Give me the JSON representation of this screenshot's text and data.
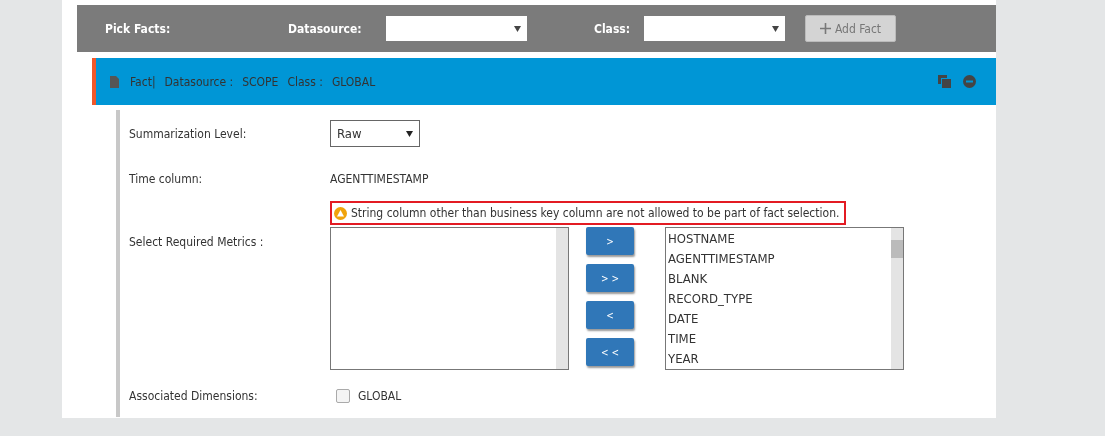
{
  "pick_bar": {
    "title": "Pick Facts:",
    "datasource_label": "Datasource:",
    "class_label": "Class:",
    "add_button": {
      "label": "Add Fact",
      "disabled": true
    }
  },
  "fact": {
    "title": "Fact|",
    "datasource_label": "Datasource :",
    "datasource": "SCOPE",
    "class_label": "Class :",
    "class": "GLOBAL"
  },
  "summarization": {
    "label": "Summarization Level:",
    "value": "Raw"
  },
  "time_column": {
    "label": "Time column:",
    "value": "AGENTTIMESTAMP"
  },
  "warning": "String column other than business key column are not allowed to be part of fact selection.",
  "metrics": {
    "label": "Select Required Metrics :",
    "buttons": [
      ">",
      "> >",
      "<",
      "< <"
    ],
    "available": [
      "HOSTNAME",
      "AGENTTIMESTAMP",
      "BLANK",
      "RECORD_TYPE",
      "DATE",
      "TIME",
      "YEAR"
    ]
  },
  "dimensions": {
    "label": "Associated Dimensions:",
    "items": [
      {
        "label": "GLOBAL",
        "checked": false
      }
    ]
  }
}
